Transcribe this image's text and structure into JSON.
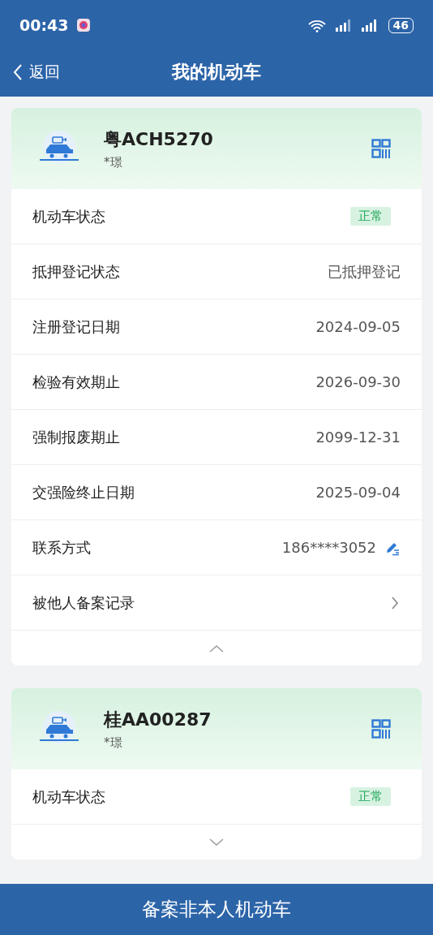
{
  "status_bar": {
    "time": "00:43",
    "battery": "46"
  },
  "nav": {
    "back": "返回",
    "title": "我的机动车"
  },
  "vehicles": [
    {
      "plate": "粤ACH5270",
      "owner": "*璟",
      "expanded": true,
      "rows": [
        {
          "kind": "badge",
          "label": "机动车状态",
          "value": "正常"
        },
        {
          "kind": "text",
          "label": "抵押登记状态",
          "value": "已抵押登记"
        },
        {
          "kind": "text",
          "label": "注册登记日期",
          "value": "2024-09-05"
        },
        {
          "kind": "text",
          "label": "检验有效期止",
          "value": "2026-09-30"
        },
        {
          "kind": "text",
          "label": "强制报废期止",
          "value": "2099-12-31"
        },
        {
          "kind": "text",
          "label": "交强险终止日期",
          "value": "2025-09-04"
        },
        {
          "kind": "phone",
          "label": "联系方式",
          "value": "186****3052"
        },
        {
          "kind": "link",
          "label": "被他人备案记录"
        }
      ]
    },
    {
      "plate": "桂AA00287",
      "owner": "*璟",
      "expanded": false,
      "rows": [
        {
          "kind": "badge",
          "label": "机动车状态",
          "value": "正常"
        }
      ]
    }
  ],
  "bottom_button": "备案非本人机动车"
}
